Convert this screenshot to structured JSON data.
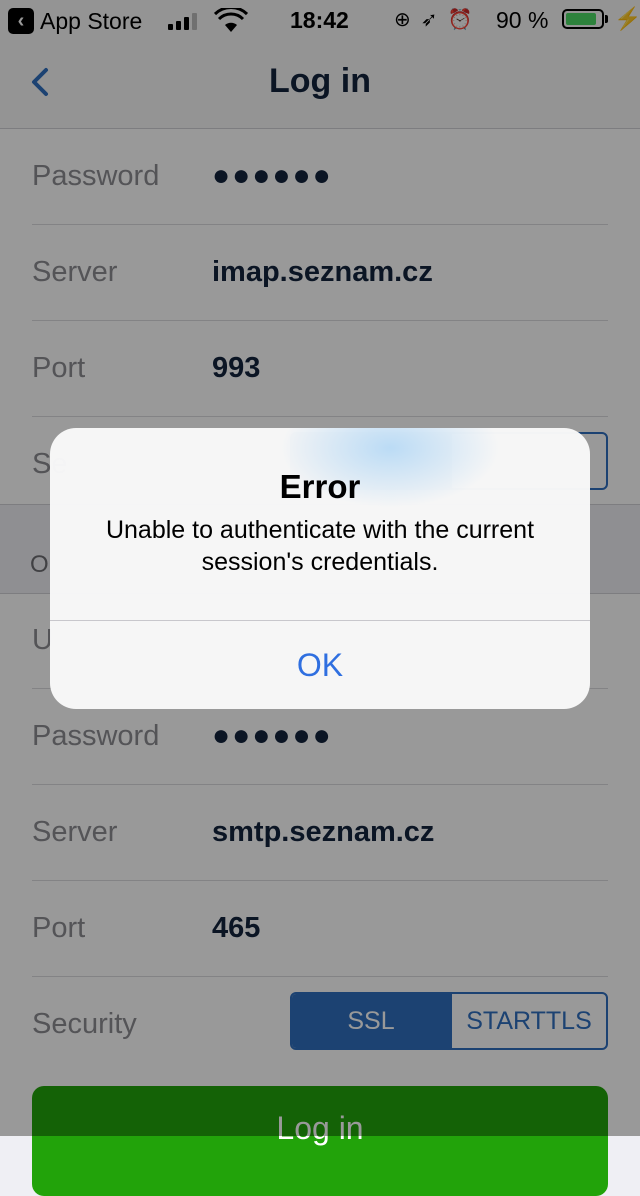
{
  "status_bar": {
    "back_app": "App Store",
    "time": "18:42",
    "battery_pct": "90 %",
    "battery_level": 0.9,
    "icons": [
      "signal-icon",
      "wifi-icon",
      "orientation-lock-icon",
      "location-icon",
      "alarm-icon",
      "battery-icon",
      "charging-icon"
    ]
  },
  "nav": {
    "title": "Log in",
    "back_icon": "chevron-left-icon"
  },
  "incoming": {
    "password_label": "Password",
    "password_value": "●●●●●●",
    "server_label": "Server",
    "server_value": "imap.seznam.cz",
    "port_label": "Port",
    "port_value": "993",
    "security_label_partial": "Se"
  },
  "outgoing_header_partial": "O",
  "outgoing": {
    "username_label_partial": "U",
    "password_label": "Password",
    "password_value": "●●●●●●",
    "server_label": "Server",
    "server_value": "smtp.seznam.cz",
    "port_label": "Port",
    "port_value": "465",
    "security_label": "Security",
    "security_options": [
      "SSL",
      "STARTTLS"
    ],
    "security_selected": "SSL"
  },
  "login_button": "Log in",
  "alert": {
    "title": "Error",
    "message": "Unable to authenticate with the current session's credentials.",
    "ok": "OK"
  },
  "colors": {
    "accent": "#2f6fbf",
    "title_text": "#13233d",
    "login_green": "#22a30a",
    "alert_ok": "#2f6fe0"
  }
}
